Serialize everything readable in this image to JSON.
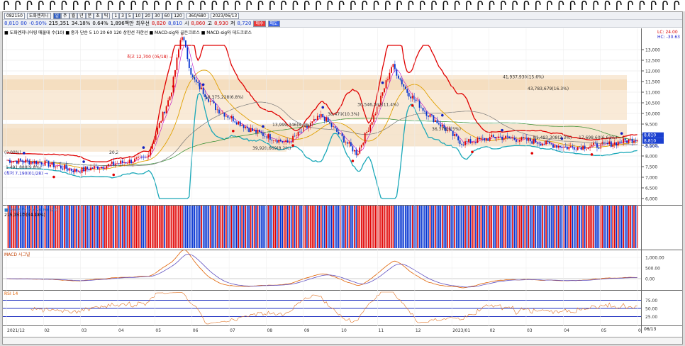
{
  "toolbar1": {
    "code": "082150",
    "name": "도화엔지니",
    "mode": [
      "일",
      "주",
      "월",
      "년",
      "분",
      "초",
      "틱"
    ],
    "periods": [
      "1",
      "3",
      "5",
      "10",
      "20",
      "30",
      "60",
      "120"
    ],
    "count": "360/680",
    "date": "2023/06/13"
  },
  "toolbar2": {
    "price": "8,810",
    "chg": "80",
    "pct": "-0.90%",
    "vol": "215,351",
    "turn": "34.18%",
    "ratio": "0.64%",
    "amt": "1,896백만",
    "preflabel": "최우선",
    "bid": "8,820",
    "ask": "8,810",
    "s_label": "시",
    "s": "8,860",
    "h_label": "고",
    "h": "8,930",
    "l_label": "저",
    "l": "8,720",
    "buy": "매수",
    "sell": "매도"
  },
  "legend_main": "■ 도화엔지니어링 매물대 수(10) ■ 종가 단순 5 10 20 60 120 상한선 하한선 ■ MACD-sig와 골든크로스 ■ MACD-sig와 데드크로스",
  "legend_vol": "■ 거래량 단순 5 20 60 120",
  "legend_vol_val": "215,351주(34.18%)",
  "legend_macd": "MACD 시그널",
  "legend_rsi": "RSI 14",
  "annotations": {
    "high": "최고 12,700 (05/18) →",
    "low": "(최저 7,190(01/28) →",
    "pct": "(0.00%)",
    "pct2": "1.491,888(9.8%)",
    "v1": "41,937,930(15.6%)",
    "v2": "43,783,679(16.3%)",
    "v3": "18,375,228(6.8%)",
    "v4": "30,546,361(11.4%)",
    "v5": "38,479(10.3%)",
    "v6": "39,920,669(8.2%)",
    "v7": "13,999,346(8.3%)",
    "v8": "61,493,308(2.3%)",
    "v9": "17,698,60(6.61%)",
    "v10": "36,376(8.5%)",
    "v11": "20,2"
  },
  "price_axis": [
    "13,000",
    "12,500",
    "12,000",
    "11,500",
    "11,000",
    "10,500",
    "10,000",
    "9,500",
    "9,000",
    "8,500",
    "8,000",
    "7,500",
    "7,000",
    "6,500",
    "6,000"
  ],
  "price_axis_top": [
    "LC: 24.00",
    "HC: -30.63"
  ],
  "price_current": "8,810",
  "price_current2": "8,810",
  "price_change": "-0.90%",
  "vol_axis": [
    "15,000K",
    "10,000K",
    "5,000K"
  ],
  "vol_current": "215,351",
  "vol_current2": "34.18%",
  "macd_axis": [
    "1,000.00",
    "500.00",
    "0.00"
  ],
  "rsi_axis": [
    "75.00",
    "50.00",
    "25.00"
  ],
  "x_axis": [
    "2021/12",
    "02",
    "03",
    "04",
    "05",
    "06",
    "07",
    "08",
    "09",
    "10",
    "11",
    "12",
    "2023/01",
    "02",
    "03",
    "04",
    "05",
    "06"
  ],
  "x_axis_right": "06/13",
  "chart_data": {
    "type": "candlestick",
    "title": "도화엔지니어링",
    "ylim": [
      6000,
      13000
    ],
    "price_months": [
      "2021/12",
      "2022/01",
      "02",
      "03",
      "04",
      "05",
      "06",
      "07",
      "08",
      "09",
      "10",
      "11",
      "12",
      "2023/01",
      "02",
      "03",
      "04",
      "05",
      "06"
    ],
    "close_approx": [
      7800,
      7700,
      7300,
      7600,
      7900,
      12300,
      10200,
      9200,
      8600,
      9900,
      8100,
      11800,
      10000,
      8600,
      8900,
      8700,
      8400,
      8500,
      8810
    ],
    "high": 12700,
    "low": 7190,
    "rsi_levels": [
      75,
      50,
      25
    ],
    "grid": true
  }
}
